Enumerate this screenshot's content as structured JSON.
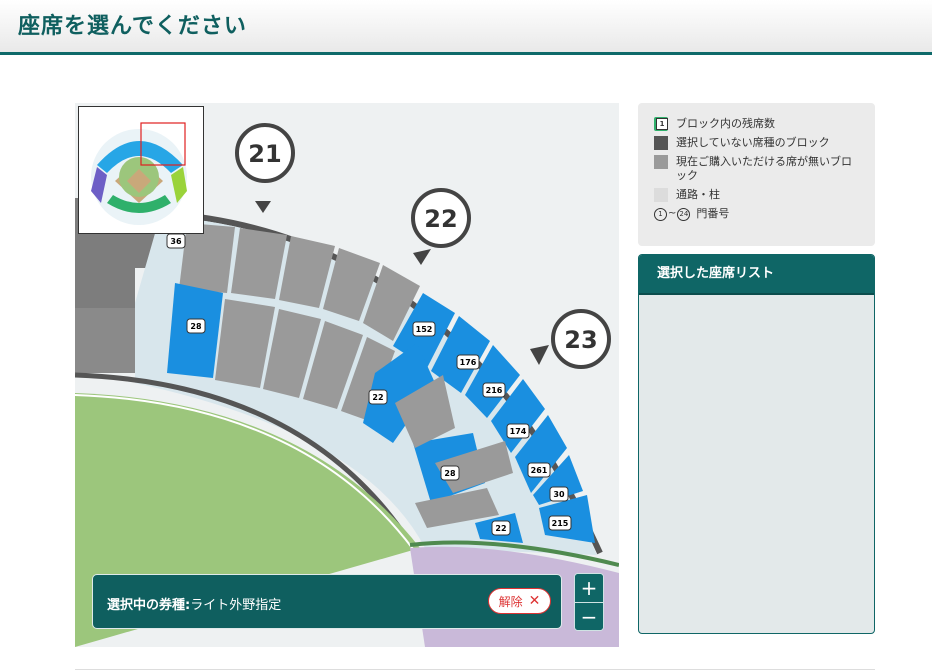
{
  "header": {
    "title": "座席を選んでください"
  },
  "map": {
    "gates": [
      "21",
      "22",
      "23"
    ],
    "blocks": {
      "b36": "36",
      "b28a": "28",
      "b152": "152",
      "b176": "176",
      "b216": "216",
      "b22a": "22",
      "b174": "174",
      "b261": "261",
      "b28b": "28",
      "b30": "30",
      "b215": "215",
      "b22b": "22"
    }
  },
  "ticket_bar": {
    "label": "選択中の券種:",
    "value": "ライト外野指定",
    "release_label": "解除"
  },
  "zoom": {
    "in_label": "+",
    "out_label": "−"
  },
  "legend": {
    "items": [
      {
        "badge": "1",
        "label": "ブロック内の残席数"
      },
      {
        "label": "選択していない席種のブロック"
      },
      {
        "label": "現在ご購入いただける席が無いブロック"
      },
      {
        "label": "通路・柱"
      },
      {
        "gate_from": "1",
        "gate_to": "24",
        "label": "門番号"
      }
    ]
  },
  "seat_list": {
    "title": "選択した座席リスト"
  },
  "colors": {
    "available": "#1a8fe0",
    "unavailable": "#9a9a9a",
    "other_type": "#555555",
    "aisle": "#dde9ef",
    "accent": "#0f6666"
  }
}
